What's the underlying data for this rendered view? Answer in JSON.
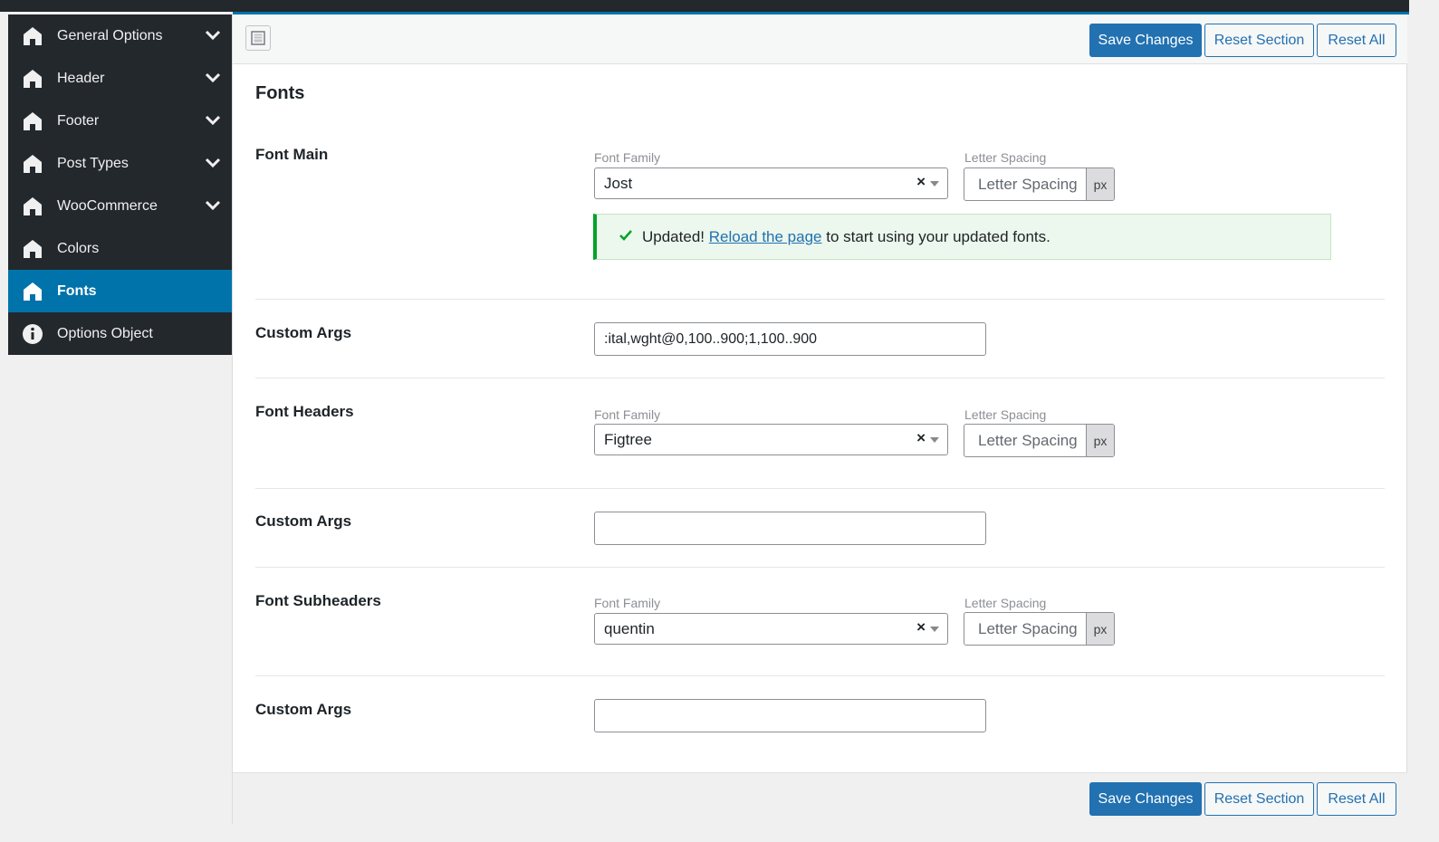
{
  "sidebar": {
    "items": [
      {
        "label": "General Options",
        "icon": "home-icon",
        "has_chevron": true
      },
      {
        "label": "Header",
        "icon": "home-icon",
        "has_chevron": true
      },
      {
        "label": "Footer",
        "icon": "home-icon",
        "has_chevron": true
      },
      {
        "label": "Post Types",
        "icon": "home-icon",
        "has_chevron": true
      },
      {
        "label": "WooCommerce",
        "icon": "home-icon",
        "has_chevron": true
      },
      {
        "label": "Colors",
        "icon": "home-icon",
        "has_chevron": false
      },
      {
        "label": "Fonts",
        "icon": "home-icon",
        "has_chevron": false,
        "active": true
      },
      {
        "label": "Options Object",
        "icon": "info-icon",
        "has_chevron": false
      }
    ]
  },
  "toolbar": {
    "save_label": "Save Changes",
    "reset_section_label": "Reset Section",
    "reset_all_label": "Reset All"
  },
  "section": {
    "title": "Fonts"
  },
  "fields": {
    "font_main": {
      "label": "Font Main",
      "family_label": "Font Family",
      "family_value": "Jost",
      "spacing_label": "Letter Spacing",
      "spacing_placeholder": "Letter Spacing",
      "unit": "px"
    },
    "notice": {
      "prefix": "Updated!",
      "link": "Reload the page",
      "suffix": "to start using your updated fonts."
    },
    "custom_args_1": {
      "label": "Custom Args",
      "value": ":ital,wght@0,100..900;1,100..900"
    },
    "font_headers": {
      "label": "Font Headers",
      "family_label": "Font Family",
      "family_value": "Figtree",
      "spacing_label": "Letter Spacing",
      "spacing_placeholder": "Letter Spacing",
      "unit": "px"
    },
    "custom_args_2": {
      "label": "Custom Args",
      "value": ""
    },
    "font_subheaders": {
      "label": "Font Subheaders",
      "family_label": "Font Family",
      "family_value": "quentin",
      "spacing_label": "Letter Spacing",
      "spacing_placeholder": "Letter Spacing",
      "unit": "px"
    },
    "custom_args_3": {
      "label": "Custom Args",
      "value": ""
    }
  },
  "colors": {
    "accent": "#0073aa",
    "primary_button": "#2271b1",
    "sidebar_bg": "#23282d",
    "notice_border": "#00a32a"
  }
}
